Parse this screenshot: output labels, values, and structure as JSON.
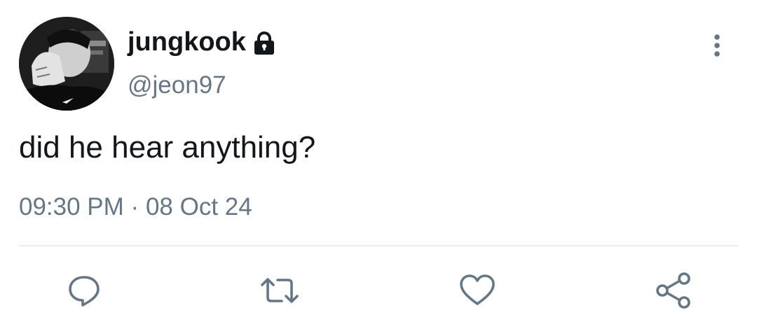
{
  "user": {
    "display_name": "jungkook",
    "handle": "@jeon97",
    "protected": true
  },
  "tweet": {
    "text": "did he hear anything?",
    "time": "09:30 PM",
    "separator": "·",
    "date": "08 Oct 24"
  },
  "icons": {
    "lock": "lock-icon",
    "more": "more-vertical-icon",
    "reply": "reply-icon",
    "retweet": "retweet-icon",
    "like": "heart-icon",
    "share": "share-icon"
  },
  "colors": {
    "primary_text": "#14171a",
    "secondary_text": "#657786",
    "divider": "#e6ecf0"
  }
}
